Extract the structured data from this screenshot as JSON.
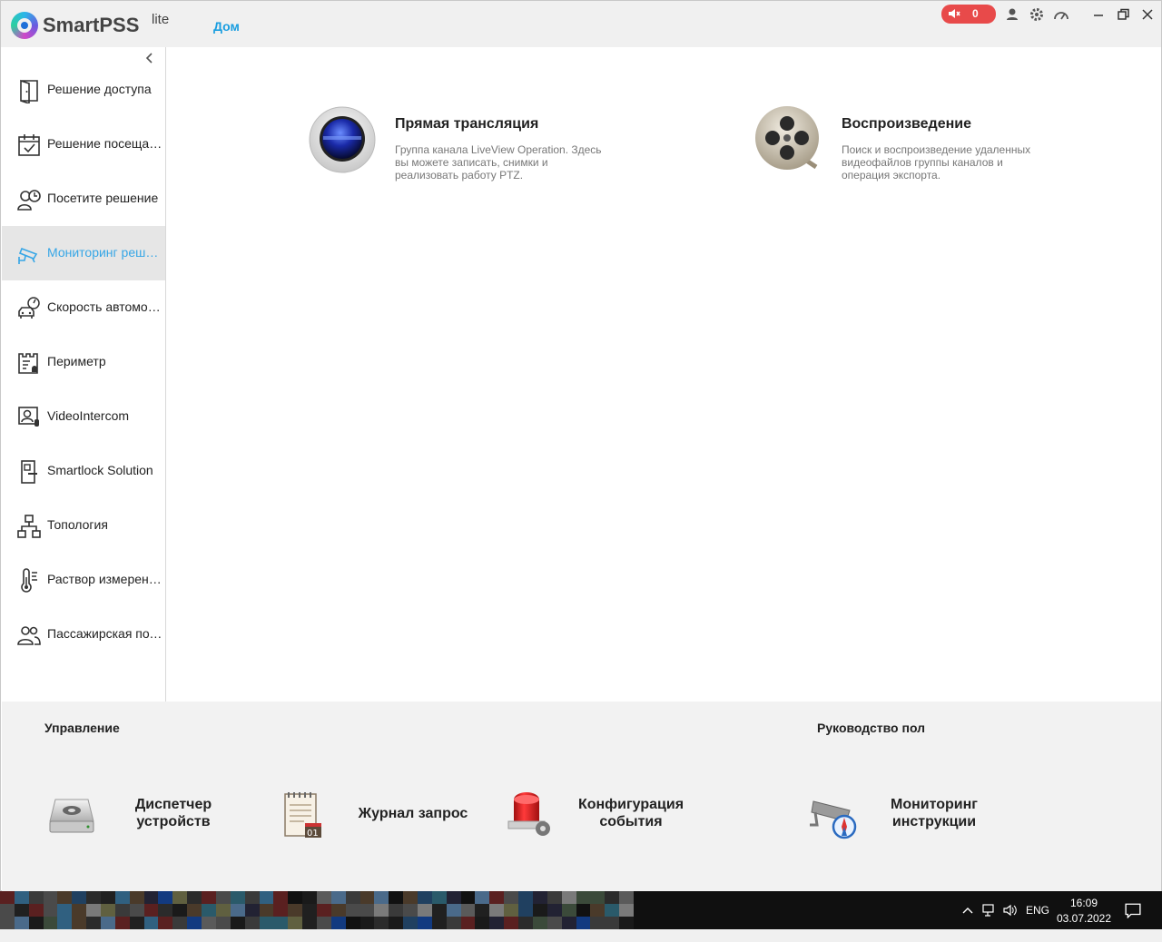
{
  "app": {
    "name": "SmartPSS",
    "edition": "lite",
    "home_tab": "Дом",
    "alarm_count": "0"
  },
  "sidebar": {
    "items": [
      {
        "label": "Решение доступа",
        "icon": "door-icon"
      },
      {
        "label": "Решение посещаемости",
        "icon": "calendar-check-icon"
      },
      {
        "label": "Посетите решение",
        "icon": "visitor-clock-icon"
      },
      {
        "label": "Мониторинг решение",
        "icon": "cctv-camera-icon",
        "active": true
      },
      {
        "label": "Скорость автомобиля",
        "icon": "car-speed-icon"
      },
      {
        "label": "Периметр",
        "icon": "perimeter-icon"
      },
      {
        "label": "VideoIntercom",
        "icon": "intercom-icon"
      },
      {
        "label": "Smartlock Solution",
        "icon": "smartlock-icon"
      },
      {
        "label": "Топология",
        "icon": "topology-icon"
      },
      {
        "label": "Раствор измерения температуры",
        "icon": "thermometer-icon"
      },
      {
        "label": "Пассажирская поток",
        "icon": "people-icon"
      }
    ]
  },
  "main": {
    "cards": [
      {
        "title": "Прямая трансляция",
        "description": "Группа канала LiveView Operation. Здесь вы можете записать, снимки и реализовать работу PTZ.",
        "icon": "camera-lens-icon"
      },
      {
        "title": "Воспроизведение",
        "description": "Поиск и воспроизведение удаленных видеофайлов группы каналов и операция экспорта.",
        "icon": "film-reel-icon"
      }
    ]
  },
  "bottom": {
    "section_manage": "Управление",
    "section_guide": "Руководство пол",
    "tools": [
      {
        "label_line1": "Диспетчер",
        "label_line2": "устройств",
        "icon": "device-manager-icon"
      },
      {
        "label_line1": "Журнал запрос",
        "label_line2": "",
        "icon": "log-notepad-icon"
      },
      {
        "label_line1": "Конфигурация",
        "label_line2": "события",
        "icon": "alarm-light-icon"
      },
      {
        "label_line1": "Мониторинг",
        "label_line2": "инструкции",
        "icon": "camera-compass-icon"
      }
    ]
  },
  "taskbar": {
    "language": "ENG",
    "time": "16:09",
    "date": "03.07.2022"
  },
  "colors": {
    "accent": "#1a9ee0",
    "active_label": "#36a6e6",
    "alarm": "#e84a4a"
  }
}
